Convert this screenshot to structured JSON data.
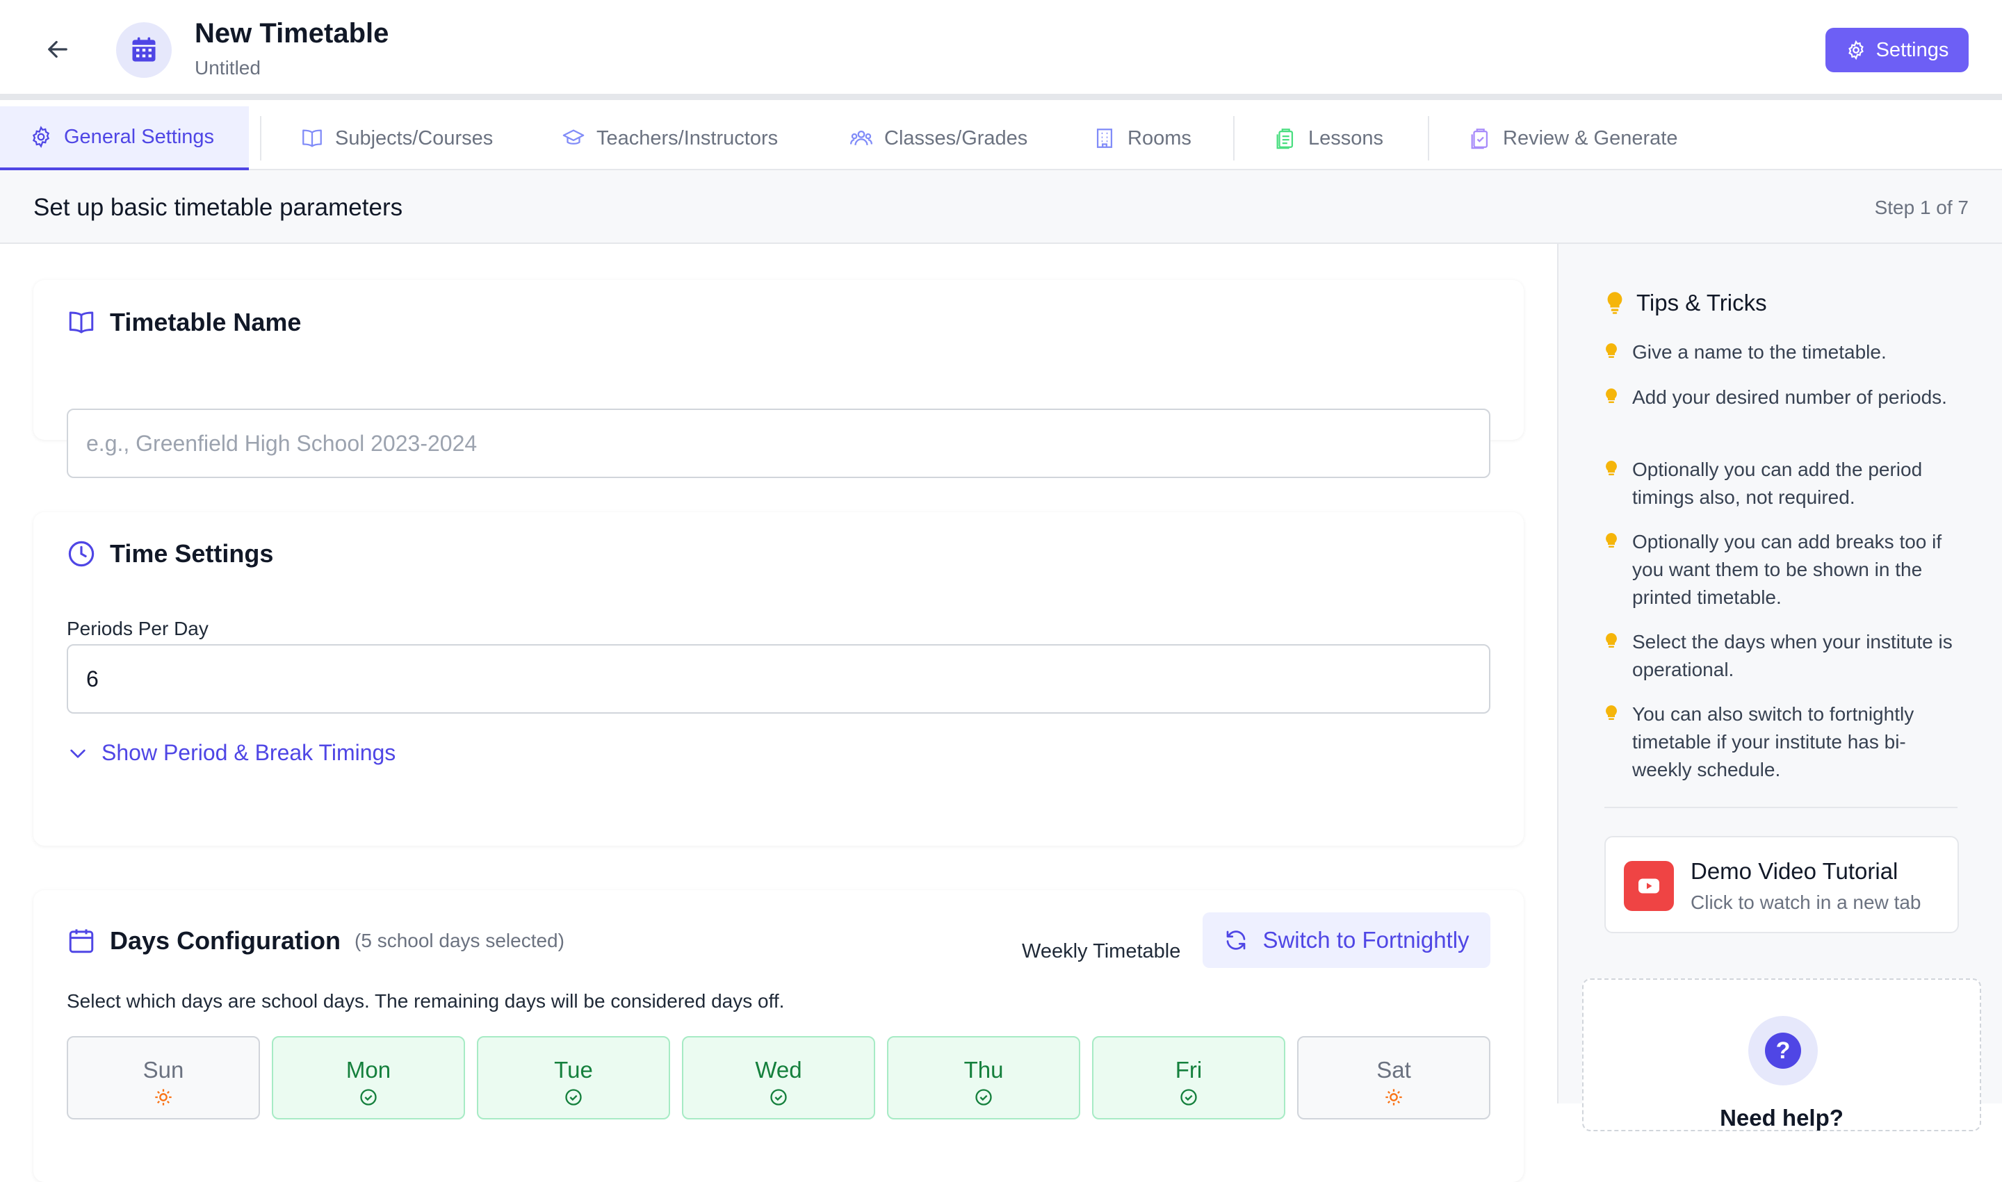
{
  "header": {
    "title": "New Timetable",
    "subtitle": "Untitled",
    "settings_label": "Settings"
  },
  "tabs": [
    {
      "label": "General Settings",
      "icon": "gear-icon",
      "active": true
    },
    {
      "label": "Subjects/Courses",
      "icon": "book-icon"
    },
    {
      "label": "Teachers/Instructors",
      "icon": "graduation-cap-icon"
    },
    {
      "label": "Classes/Grades",
      "icon": "users-icon"
    },
    {
      "label": "Rooms",
      "icon": "building-icon"
    },
    {
      "label": "Lessons",
      "icon": "clipboard-icon"
    },
    {
      "label": "Review & Generate",
      "icon": "clipboard-check-icon"
    }
  ],
  "stepbar": {
    "heading": "Set up basic timetable parameters",
    "step": "Step 1 of 7"
  },
  "timetable_name": {
    "heading": "Timetable Name",
    "placeholder": "e.g., Greenfield High School 2023-2024",
    "value": ""
  },
  "time_settings": {
    "heading": "Time Settings",
    "periods_label": "Periods Per Day",
    "periods_value": "6",
    "toggle_label": "Show Period & Break Timings"
  },
  "days": {
    "heading": "Days Configuration",
    "count_note": "(5 school days selected)",
    "mode_label": "Weekly Timetable",
    "switch_label": "Switch to Fortnightly",
    "instruction": "Select which days are school days. The remaining days will be considered days off.",
    "items": [
      {
        "label": "Sun",
        "school_day": false
      },
      {
        "label": "Mon",
        "school_day": true
      },
      {
        "label": "Tue",
        "school_day": true
      },
      {
        "label": "Wed",
        "school_day": true
      },
      {
        "label": "Thu",
        "school_day": true
      },
      {
        "label": "Fri",
        "school_day": true
      },
      {
        "label": "Sat",
        "school_day": false
      }
    ]
  },
  "tips": {
    "heading": "Tips & Tricks",
    "items": [
      "Give a name to the timetable.",
      "Add your desired number of periods.",
      "Optionally you can add the period timings also, not required.",
      "Optionally you can add breaks too if you want them to be shown in the printed timetable.",
      "Select the days when your institute is operational.",
      "You can also switch to fortnightly timetable if your institute has bi-weekly schedule."
    ]
  },
  "video": {
    "title": "Demo Video Tutorial",
    "subtitle": "Click to watch in a new tab"
  },
  "help": {
    "title": "Need help?",
    "icon_glyph": "?"
  },
  "colors": {
    "accent": "#4f46e5",
    "button": "#6d5ff5",
    "school_day": "#15803d",
    "day_off": "#f97316",
    "tip_bulb": "#f5b50a",
    "youtube": "#ef4444"
  }
}
